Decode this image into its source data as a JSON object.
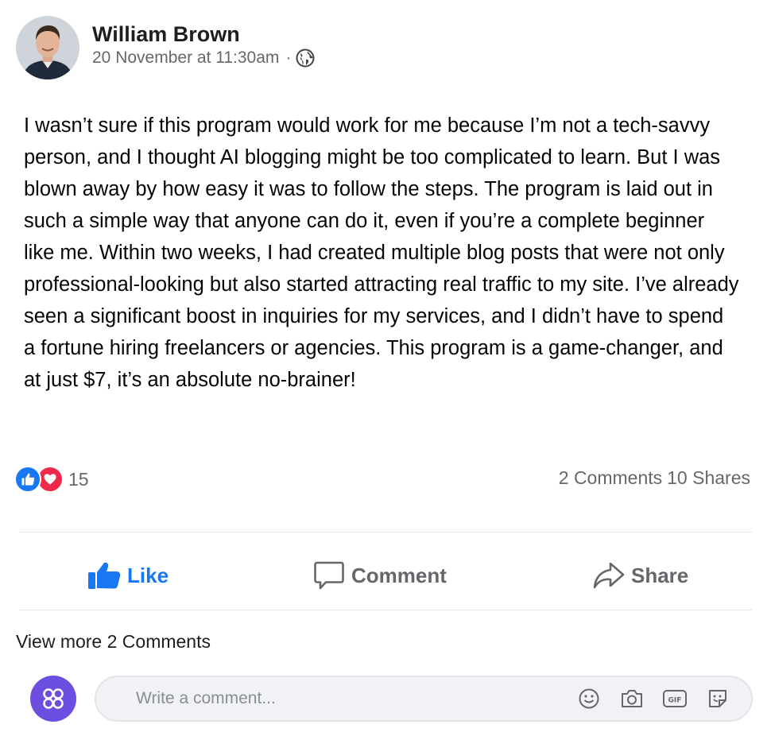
{
  "post": {
    "author": "William Brown",
    "timestamp": "20 November at 11:30am",
    "separator": "·",
    "audience_icon": "globe-icon",
    "body": "I wasn’t sure if this program would work for me because I’m not a tech-savvy person, and I thought AI blogging might be too complicated to learn. But I was blown away by how easy it was to follow the steps. The program is laid out in such a simple way that anyone can do it, even if you’re a complete beginner like me. Within two weeks, I had created multiple blog posts that were not only professional-looking but also started attracting real traffic to my site. I’ve already seen a significant boost in inquiries for my services, and I didn’t have to spend a fortune hiring freelancers or agencies. This program is a game-changer, and at just $7, it’s an absolute no-brainer!"
  },
  "reactions": {
    "icons": [
      "like-reaction-icon",
      "love-reaction-icon"
    ],
    "count": "15",
    "comments_count": "2 Comments",
    "shares_count": "10 Shares"
  },
  "actions": {
    "like": "Like",
    "comment": "Comment",
    "share": "Share"
  },
  "comments": {
    "view_more": "View more 2 Comments",
    "placeholder": "Write a comment...",
    "tools": [
      "emoji-icon",
      "camera-icon",
      "gif-icon",
      "sticker-icon"
    ]
  },
  "colors": {
    "accent": "#1877f2",
    "love": "#f02849",
    "muted": "#65676b",
    "commenter_avatar": "#6c4fe0"
  }
}
